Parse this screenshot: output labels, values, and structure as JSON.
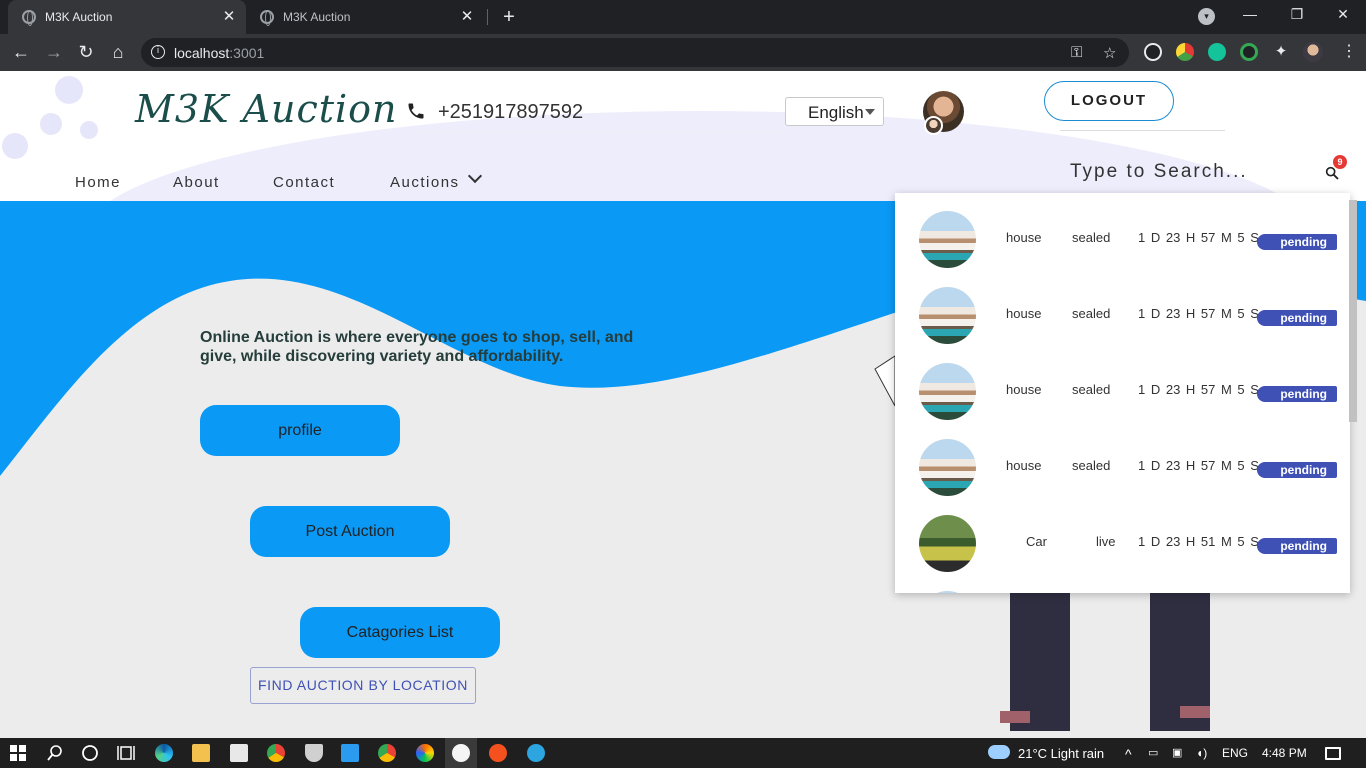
{
  "browser": {
    "tabs": [
      {
        "title": "M3K Auction",
        "active": true
      },
      {
        "title": "M3K Auction",
        "active": false
      }
    ],
    "url_host": "localhost",
    "url_port": ":3001"
  },
  "header": {
    "logo": "M3K Auction",
    "phone": "+251917897592",
    "language": "English",
    "logout": "LOGOUT",
    "nav": [
      "Home",
      "About",
      "Contact",
      "Auctions"
    ],
    "search_placeholder": "Type to Search...",
    "notification_count": "9"
  },
  "hero": {
    "tagline": "Online Auction is where everyone goes to shop, sell, and give, while discovering variety and affordability.",
    "buttons": {
      "profile": "profile",
      "post_auction": "Post Auction",
      "categories": "Catagories List",
      "find_by_location": "FIND AUCTION BY LOCATION"
    }
  },
  "results": [
    {
      "image": "house",
      "name": "house",
      "type": "sealed",
      "timer": "1 D 23 H 57 M 5 S",
      "status": "pending"
    },
    {
      "image": "house",
      "name": "house",
      "type": "sealed",
      "timer": "1 D 23 H 57 M 5 S",
      "status": "pending"
    },
    {
      "image": "house",
      "name": "house",
      "type": "sealed",
      "timer": "1 D 23 H 57 M 5 S",
      "status": "pending"
    },
    {
      "image": "house",
      "name": "house",
      "type": "sealed",
      "timer": "1 D 23 H 57 M 5 S",
      "status": "pending"
    },
    {
      "image": "car",
      "name": "Car",
      "type": "live",
      "timer": "1 D 23 H 51 M 5 S",
      "status": "pending"
    }
  ],
  "taskbar": {
    "weather": "21°C  Light rain",
    "language": "ENG",
    "time": "4:48 PM"
  },
  "colors": {
    "accent_blue": "#0a99f5",
    "status_blue": "#3f51b5",
    "logo_green": "#1b4e4a"
  }
}
